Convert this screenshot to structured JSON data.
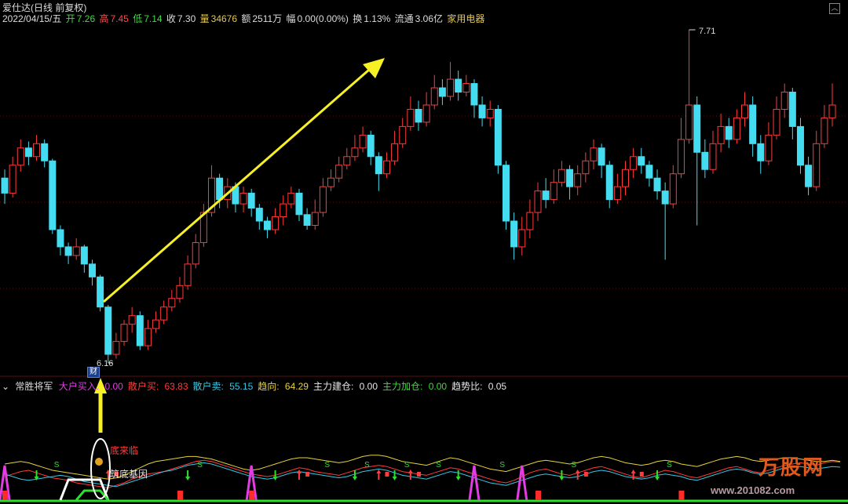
{
  "header": {
    "title": "爱仕达(日线 前复权)",
    "date": "2022/04/15/五",
    "open_label": "开",
    "open": "7.26",
    "high_label": "高",
    "high": "7.45",
    "low_label": "低",
    "low": "7.14",
    "close_label": "收",
    "close": "7.30",
    "vol_label": "量",
    "vol": "34676",
    "amt_label": "额",
    "amt": "2511万",
    "amp_label": "幅",
    "amp": "0.00(0.00%)",
    "turn_label": "换",
    "turn": "1.13%",
    "float_label": "流通",
    "float": "3.06亿",
    "sector": "家用电器"
  },
  "price_markers": {
    "low": "6.16",
    "high": "7.71",
    "badge": "财"
  },
  "indicator": {
    "name": "常胜将军",
    "items": [
      {
        "label": "大户买入:",
        "value": "0.00",
        "color": "#e43ce4"
      },
      {
        "label": "散户买:",
        "value": "63.83",
        "color": "#ff3b3b"
      },
      {
        "label": "散户卖:",
        "value": "55.15",
        "color": "#36c8e6"
      },
      {
        "label": "趋向:",
        "value": "64.29",
        "color": "#e6d23a"
      },
      {
        "label": "主力建仓:",
        "value": "0.00",
        "color": "#e6e6e6"
      },
      {
        "label": "主力加仓:",
        "value": "0.00",
        "color": "#3cdc3c"
      },
      {
        "label": "趋势比:",
        "value": "0.05",
        "color": "#e6e6e6"
      }
    ],
    "anno1": "底来临",
    "anno2": "筑底基因"
  },
  "watermark": {
    "logo": "万股网",
    "url": "www.201082.com"
  },
  "colors": {
    "up": "#ff3b3b",
    "down": "#44dcf0",
    "arrow": "#f6f025",
    "grid": "#5a1010"
  },
  "chart_data": {
    "type": "candlestick",
    "price_range": [
      6.16,
      7.71
    ],
    "bars": [
      [
        7.02,
        6.95,
        7.06,
        6.9
      ],
      [
        6.95,
        7.08,
        7.12,
        6.93
      ],
      [
        7.08,
        7.16,
        7.2,
        7.05
      ],
      [
        7.16,
        7.12,
        7.19,
        7.08
      ],
      [
        7.12,
        7.18,
        7.22,
        7.1
      ],
      [
        7.18,
        7.1,
        7.2,
        7.07
      ],
      [
        7.1,
        6.78,
        7.11,
        6.76
      ],
      [
        6.78,
        6.7,
        6.8,
        6.66
      ],
      [
        6.7,
        6.66,
        6.72,
        6.62
      ],
      [
        6.66,
        6.7,
        6.74,
        6.64
      ],
      [
        6.7,
        6.62,
        6.71,
        6.58
      ],
      [
        6.62,
        6.56,
        6.64,
        6.52
      ],
      [
        6.56,
        6.42,
        6.57,
        6.4
      ],
      [
        6.42,
        6.2,
        6.43,
        6.16
      ],
      [
        6.2,
        6.26,
        6.3,
        6.18
      ],
      [
        6.26,
        6.34,
        6.36,
        6.24
      ],
      [
        6.34,
        6.38,
        6.42,
        6.3
      ],
      [
        6.38,
        6.24,
        6.4,
        6.22
      ],
      [
        6.24,
        6.32,
        6.36,
        6.22
      ],
      [
        6.32,
        6.36,
        6.4,
        6.3
      ],
      [
        6.36,
        6.42,
        6.45,
        6.34
      ],
      [
        6.42,
        6.46,
        6.5,
        6.4
      ],
      [
        6.46,
        6.52,
        6.56,
        6.44
      ],
      [
        6.52,
        6.62,
        6.66,
        6.5
      ],
      [
        6.62,
        6.72,
        6.76,
        6.6
      ],
      [
        6.72,
        6.86,
        6.9,
        6.7
      ],
      [
        6.86,
        7.02,
        7.08,
        6.84
      ],
      [
        7.02,
        6.92,
        7.04,
        6.88
      ],
      [
        6.92,
        6.98,
        7.02,
        6.88
      ],
      [
        6.98,
        6.9,
        7.0,
        6.86
      ],
      [
        6.9,
        6.95,
        6.98,
        6.86
      ],
      [
        6.95,
        6.88,
        6.97,
        6.84
      ],
      [
        6.88,
        6.82,
        6.9,
        6.78
      ],
      [
        6.82,
        6.78,
        6.84,
        6.74
      ],
      [
        6.78,
        6.84,
        6.88,
        6.76
      ],
      [
        6.84,
        6.9,
        6.94,
        6.8
      ],
      [
        6.9,
        6.95,
        6.98,
        6.88
      ],
      [
        6.95,
        6.85,
        6.97,
        6.82
      ],
      [
        6.85,
        6.8,
        6.88,
        6.78
      ],
      [
        6.8,
        6.86,
        6.92,
        6.78
      ],
      [
        6.86,
        6.98,
        7.02,
        6.84
      ],
      [
        6.98,
        7.02,
        7.06,
        6.96
      ],
      [
        7.02,
        7.08,
        7.12,
        7.0
      ],
      [
        7.08,
        7.12,
        7.16,
        7.06
      ],
      [
        7.12,
        7.16,
        7.22,
        7.1
      ],
      [
        7.16,
        7.22,
        7.26,
        7.14
      ],
      [
        7.22,
        7.12,
        7.24,
        7.08
      ],
      [
        7.12,
        7.04,
        7.14,
        6.96
      ],
      [
        7.04,
        7.1,
        7.14,
        7.02
      ],
      [
        7.1,
        7.18,
        7.24,
        7.08
      ],
      [
        7.18,
        7.26,
        7.3,
        7.16
      ],
      [
        7.26,
        7.34,
        7.4,
        7.24
      ],
      [
        7.34,
        7.28,
        7.38,
        7.24
      ],
      [
        7.28,
        7.36,
        7.42,
        7.26
      ],
      [
        7.36,
        7.44,
        7.5,
        7.34
      ],
      [
        7.44,
        7.4,
        7.48,
        7.36
      ],
      [
        7.4,
        7.48,
        7.56,
        7.38
      ],
      [
        7.48,
        7.42,
        7.52,
        7.38
      ],
      [
        7.42,
        7.46,
        7.5,
        7.4
      ],
      [
        7.46,
        7.36,
        7.48,
        7.3
      ],
      [
        7.36,
        7.3,
        7.4,
        7.26
      ],
      [
        7.3,
        7.34,
        7.38,
        7.26
      ],
      [
        7.34,
        7.08,
        7.36,
        7.04
      ],
      [
        7.08,
        6.82,
        7.1,
        6.78
      ],
      [
        6.82,
        6.7,
        6.86,
        6.64
      ],
      [
        6.7,
        6.78,
        6.84,
        6.66
      ],
      [
        6.78,
        6.86,
        6.92,
        6.74
      ],
      [
        6.86,
        6.96,
        7.0,
        6.82
      ],
      [
        6.96,
        6.92,
        7.02,
        6.88
      ],
      [
        6.92,
        7.0,
        7.06,
        6.9
      ],
      [
        7.0,
        7.06,
        7.1,
        6.98
      ],
      [
        7.06,
        6.98,
        7.08,
        6.92
      ],
      [
        6.98,
        7.04,
        7.08,
        6.94
      ],
      [
        7.04,
        7.1,
        7.14,
        7.0
      ],
      [
        7.1,
        7.16,
        7.2,
        7.06
      ],
      [
        7.16,
        7.08,
        7.18,
        7.02
      ],
      [
        7.08,
        6.92,
        7.1,
        6.88
      ],
      [
        6.92,
        6.98,
        7.04,
        6.9
      ],
      [
        6.98,
        7.06,
        7.1,
        6.94
      ],
      [
        7.06,
        7.12,
        7.16,
        7.02
      ],
      [
        7.12,
        7.08,
        7.16,
        7.04
      ],
      [
        7.08,
        7.02,
        7.1,
        6.98
      ],
      [
        7.02,
        6.96,
        7.06,
        6.92
      ],
      [
        6.96,
        6.9,
        7.0,
        6.64
      ],
      [
        6.9,
        7.04,
        7.08,
        6.88
      ],
      [
        7.04,
        7.2,
        7.3,
        7.02
      ],
      [
        7.2,
        7.36,
        7.71,
        7.18
      ],
      [
        7.36,
        7.14,
        7.4,
        6.8
      ],
      [
        7.14,
        7.06,
        7.2,
        7.02
      ],
      [
        7.06,
        7.18,
        7.24,
        7.04
      ],
      [
        7.18,
        7.26,
        7.32,
        7.14
      ],
      [
        7.26,
        7.2,
        7.3,
        7.16
      ],
      [
        7.2,
        7.3,
        7.34,
        7.18
      ],
      [
        7.3,
        7.36,
        7.42,
        7.26
      ],
      [
        7.36,
        7.18,
        7.4,
        7.12
      ],
      [
        7.18,
        7.1,
        7.22,
        7.04
      ],
      [
        7.1,
        7.22,
        7.28,
        7.08
      ],
      [
        7.22,
        7.34,
        7.4,
        7.2
      ],
      [
        7.34,
        7.42,
        7.46,
        7.3
      ],
      [
        7.42,
        7.26,
        7.44,
        7.2
      ],
      [
        7.26,
        7.08,
        7.3,
        7.04
      ],
      [
        7.08,
        6.98,
        7.12,
        6.94
      ],
      [
        6.98,
        7.18,
        7.24,
        6.96
      ],
      [
        7.18,
        7.3,
        7.36,
        7.16
      ],
      [
        7.3,
        7.36,
        7.46,
        7.26
      ]
    ],
    "indicator_series": [
      {
        "color": "#ff3b3b",
        "values": [
          40,
          44,
          48,
          50,
          46,
          42,
          38,
          36,
          34,
          30,
          28,
          26,
          24,
          22,
          26,
          30,
          36,
          40,
          44,
          46,
          48,
          52,
          56,
          60,
          64,
          66,
          64,
          60,
          56,
          52,
          48,
          44,
          42,
          40,
          42,
          46,
          50,
          54,
          52,
          48,
          46,
          44,
          42,
          46,
          50,
          54,
          56,
          58,
          56,
          52,
          48,
          46,
          44,
          42,
          46,
          50,
          54,
          52,
          48,
          44,
          40,
          36,
          32,
          30,
          34,
          40,
          46,
          50,
          52,
          48,
          44,
          42,
          46,
          50,
          54,
          56,
          52,
          48,
          44,
          40,
          38,
          42,
          46,
          50,
          48,
          44,
          40,
          38,
          42,
          46,
          50,
          54,
          56,
          52,
          48,
          46,
          50,
          54,
          58,
          60,
          62,
          60,
          58,
          62,
          64,
          63
        ]
      },
      {
        "color": "#36c8e6",
        "values": [
          44,
          40,
          36,
          34,
          36,
          38,
          40,
          42,
          40,
          36,
          32,
          30,
          28,
          26,
          24,
          28,
          32,
          36,
          40,
          44,
          48,
          50,
          54,
          58,
          60,
          62,
          60,
          56,
          52,
          48,
          44,
          40,
          38,
          36,
          38,
          42,
          46,
          48,
          46,
          44,
          42,
          40,
          38,
          40,
          44,
          48,
          50,
          52,
          50,
          46,
          42,
          40,
          38,
          36,
          40,
          44,
          48,
          46,
          42,
          38,
          34,
          30,
          28,
          26,
          30,
          34,
          38,
          42,
          44,
          42,
          40,
          38,
          40,
          44,
          48,
          50,
          48,
          44,
          40,
          38,
          36,
          38,
          42,
          44,
          42,
          40,
          36,
          34,
          38,
          42,
          46,
          50,
          52,
          50,
          46,
          44,
          46,
          50,
          54,
          56,
          56,
          54,
          52,
          54,
          56,
          55
        ]
      },
      {
        "color": "#e6d23a",
        "values": [
          60,
          62,
          64,
          62,
          58,
          54,
          50,
          48,
          46,
          44,
          42,
          40,
          38,
          36,
          38,
          42,
          48,
          54,
          60,
          64,
          66,
          68,
          70,
          72,
          72,
          70,
          68,
          64,
          60,
          56,
          52,
          50,
          52,
          56,
          60,
          64,
          68,
          70,
          70,
          68,
          66,
          64,
          62,
          64,
          68,
          72,
          74,
          74,
          72,
          68,
          64,
          62,
          60,
          58,
          62,
          66,
          70,
          68,
          64,
          60,
          56,
          52,
          50,
          48,
          52,
          56,
          60,
          64,
          66,
          64,
          62,
          60,
          62,
          66,
          70,
          72,
          70,
          66,
          62,
          60,
          58,
          60,
          64,
          66,
          64,
          60,
          58,
          56,
          60,
          64,
          68,
          70,
          72,
          70,
          66,
          64,
          66,
          68,
          70,
          70,
          68,
          66,
          64,
          64,
          66,
          64
        ]
      }
    ],
    "magenta_spikes": [
      0,
      31,
      59,
      65
    ],
    "white_block": [
      7,
      13
    ],
    "red_bars": [
      0,
      22,
      31,
      67,
      85
    ],
    "arrows_down": [
      4,
      23,
      34,
      44,
      49,
      57,
      70,
      82
    ],
    "arrows_up": [
      13,
      37,
      47,
      51,
      72,
      79
    ],
    "s_marks": [
      6,
      24,
      40,
      45,
      50,
      54,
      62,
      71,
      83
    ],
    "b_marks": [
      14,
      38,
      48,
      52,
      73,
      80
    ]
  }
}
